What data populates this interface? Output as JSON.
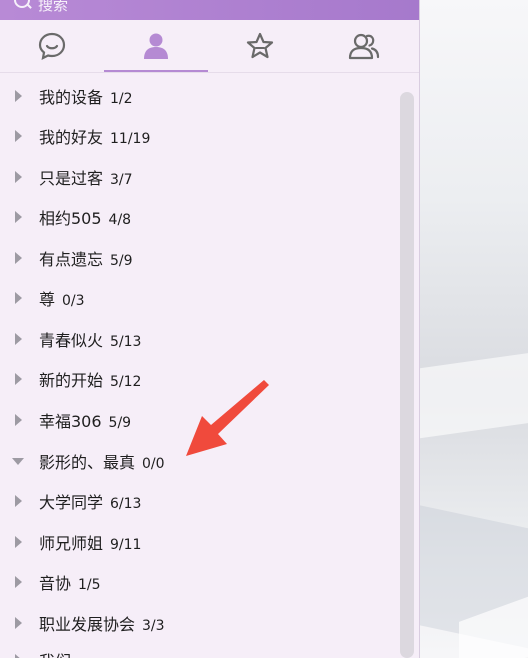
{
  "search": {
    "label": "搜索"
  },
  "tabs": [
    {
      "name": "conversations",
      "icon": "chat-bubble-icon",
      "active": false
    },
    {
      "name": "contacts",
      "icon": "person-icon",
      "active": true
    },
    {
      "name": "favorites",
      "icon": "star-icon",
      "active": false
    },
    {
      "name": "groups",
      "icon": "people-icon",
      "active": false
    }
  ],
  "groups": [
    {
      "name": "我的设备",
      "count": "1/2",
      "expanded": false
    },
    {
      "name": "我的好友",
      "count": "11/19",
      "expanded": false
    },
    {
      "name": "只是过客",
      "count": "3/7",
      "expanded": false
    },
    {
      "name": "相约505",
      "count": "4/8",
      "expanded": false
    },
    {
      "name": "有点遗忘",
      "count": "5/9",
      "expanded": false
    },
    {
      "name": "尊",
      "count": "0/3",
      "expanded": false
    },
    {
      "name": "青春似火",
      "count": "5/13",
      "expanded": false
    },
    {
      "name": "新的开始",
      "count": "5/12",
      "expanded": false
    },
    {
      "name": "幸福306",
      "count": "5/9",
      "expanded": false
    },
    {
      "name": "影形的、最真",
      "count": "0/0",
      "expanded": true
    },
    {
      "name": "大学同学",
      "count": "6/13",
      "expanded": false
    },
    {
      "name": "师兄师姐",
      "count": "9/11",
      "expanded": false
    },
    {
      "name": "音协",
      "count": "1/5",
      "expanded": false
    },
    {
      "name": "职业发展协会",
      "count": "3/3",
      "expanded": false
    },
    {
      "name": "我们",
      "count": "",
      "expanded": false
    }
  ],
  "colors": {
    "accent": "#b58ad3",
    "panel": "#f6eef8",
    "annotation_arrow": "#f04a3c"
  }
}
